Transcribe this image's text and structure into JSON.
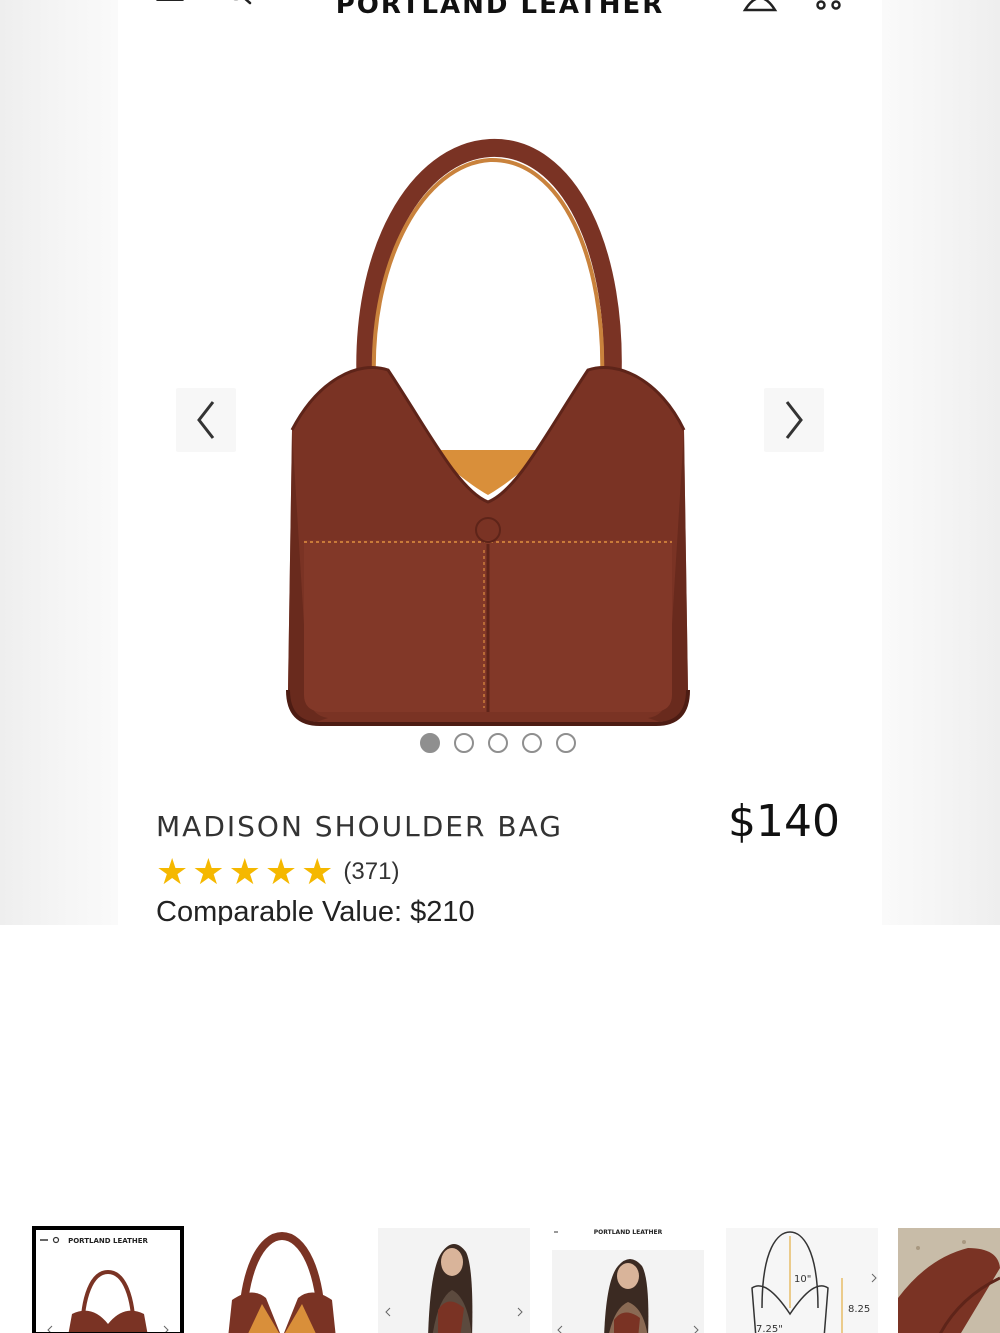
{
  "header": {
    "brand": "PORTLAND LEATHER",
    "menu_icon": "hamburger-menu-icon",
    "search_icon": "search-icon",
    "account_icon": "account-icon",
    "cart_icon": "cart-icon"
  },
  "carousel": {
    "prev_icon": "chevron-left-icon",
    "next_icon": "chevron-right-icon",
    "slide_count": 5,
    "active_slide": 1
  },
  "product": {
    "name": "MADISON SHOULDER BAG",
    "price": "$140",
    "rating_stars": 5,
    "review_count": "(371)",
    "comparable_value": "Comparable Value: $210"
  },
  "colors": {
    "leather": "#7a3324",
    "lining": "#d98f3a",
    "star": "#f5b800"
  },
  "thumbnails": {
    "items": [
      {
        "label": "screenshot-thumbnail",
        "selected": true,
        "brand_text": "PORTLAND LEATHER"
      },
      {
        "label": "bag-closeup-thumbnail",
        "selected": false
      },
      {
        "label": "model-thumbnail",
        "selected": false
      },
      {
        "label": "model-screenshot-thumbnail",
        "selected": false,
        "brand_text": "PORTLAND LEATHER"
      },
      {
        "label": "dimensions-thumbnail",
        "selected": false,
        "dims": [
          "10\"",
          "8.25",
          "7.25\""
        ]
      },
      {
        "label": "texture-thumbnail",
        "selected": false
      }
    ]
  }
}
